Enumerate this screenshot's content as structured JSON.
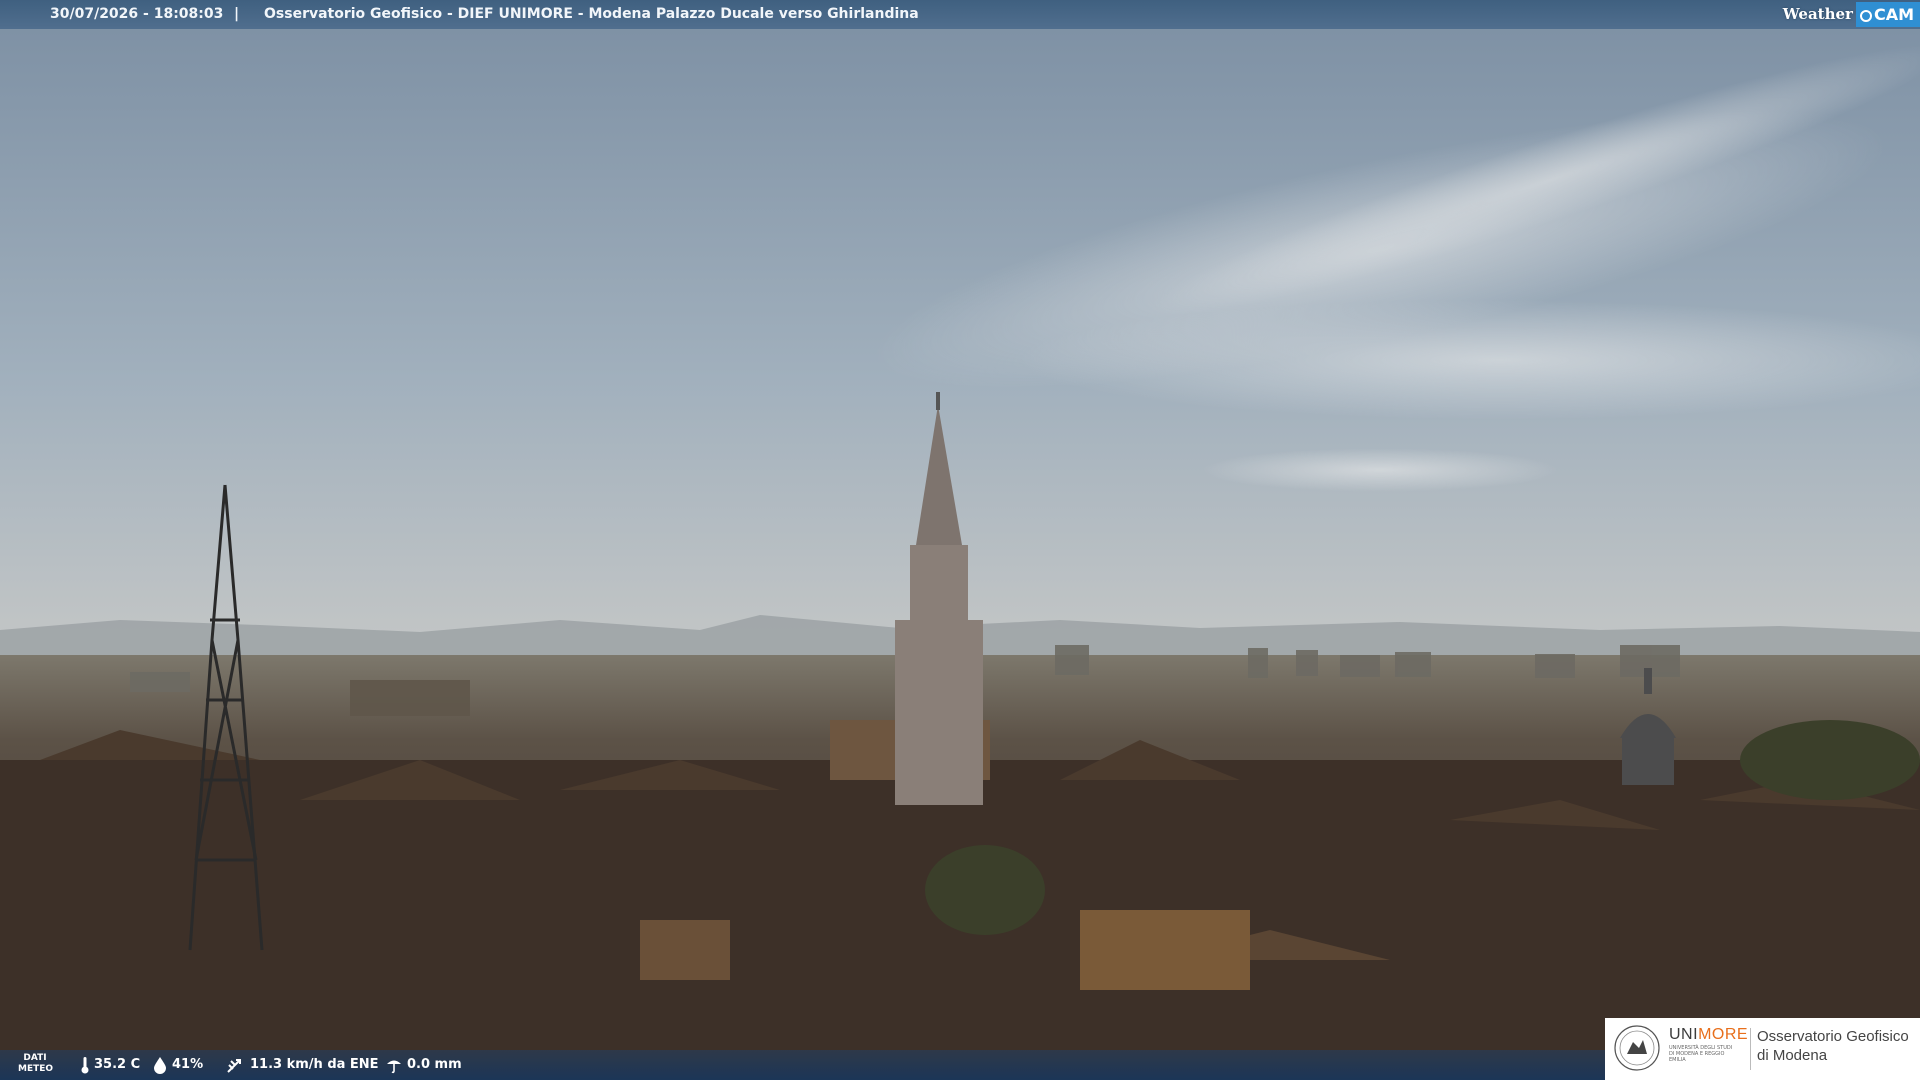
{
  "top_bar": {
    "timestamp": "30/07/2026 - 18:08:03",
    "separator": "|",
    "caption": "Osservatorio Geofisico - DIEF UNIMORE - Modena Palazzo Ducale verso Ghirlandina",
    "brand_weather": "Weather",
    "brand_cam": "CAM"
  },
  "bottom_bar": {
    "dati_label_1": "DATI",
    "dati_label_2": "METEO",
    "temperature": "35.2 C",
    "humidity": "41%",
    "wind": "11.3 km/h da ENE",
    "rain": "0.0 mm"
  },
  "logo": {
    "uni": "UNI",
    "more": "MORE",
    "subtitle": "UNIVERSITÀ DEGLI STUDI DI MODENA E REGGIO EMILIA",
    "observatory_line1": "Osservatorio Geofisico",
    "observatory_line2": "di Modena"
  },
  "colors": {
    "accent_orange": "#e86f1c",
    "bar_blue": "#3a5c7d",
    "cam_blue": "#2f8fd3"
  },
  "icons": [
    "thermometer-icon",
    "droplet-icon",
    "wind-icon",
    "rain-gauge-icon",
    "unimore-seal-icon"
  ]
}
